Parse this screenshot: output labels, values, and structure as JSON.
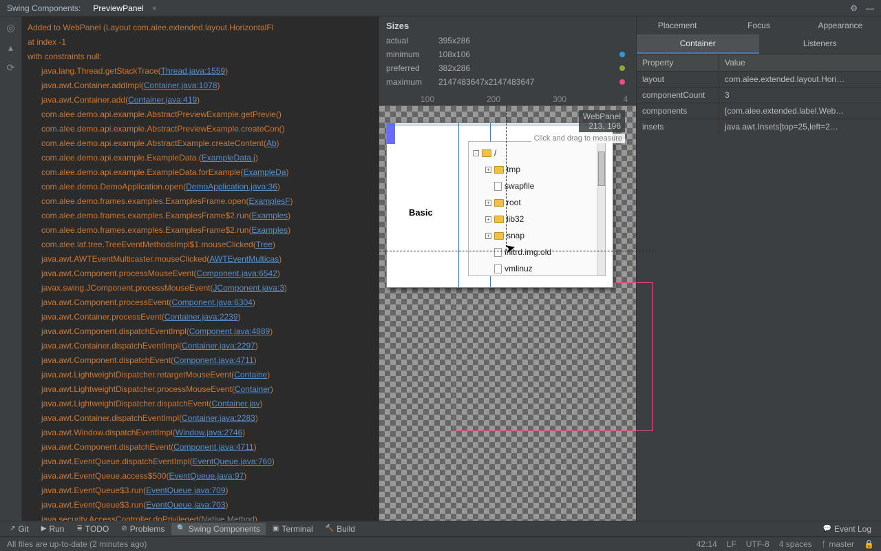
{
  "header": {
    "breadcrumb": "Swing Components:",
    "tab": "PreviewPanel"
  },
  "stack": {
    "header1": "Added to WebPanel (Layout com.alee.extended.layout.HorizontalFl",
    "header2": "at index -1",
    "header3": "with constraints null:",
    "frames": [
      {
        "call": "java.lang.Thread.getStackTrace",
        "src": "Thread.java:1559"
      },
      {
        "call": "java.awt.Container.addImpl",
        "src": "Container.java:1078"
      },
      {
        "call": "java.awt.Container.add",
        "src": "Container.java:419"
      },
      {
        "call": "com.alee.demo.api.example.AbstractPreviewExample.getPrevie",
        "src": ""
      },
      {
        "call": "com.alee.demo.api.example.AbstractPreviewExample.createCon",
        "src": ""
      },
      {
        "call": "com.alee.demo.api.example.AbstractExample.createContent",
        "src": "Ab"
      },
      {
        "call": "com.alee.demo.api.example.ExampleData.<init>",
        "src": "ExampleData.j"
      },
      {
        "call": "com.alee.demo.api.example.ExampleData.forExample",
        "src": "ExampleDa"
      },
      {
        "call": "com.alee.demo.DemoApplication.open",
        "src": "DemoApplication.java:36"
      },
      {
        "call": "com.alee.demo.frames.examples.ExamplesFrame.open",
        "src": "ExamplesF"
      },
      {
        "call": "com.alee.demo.frames.examples.ExamplesFrame$2.run",
        "src": "Examples"
      },
      {
        "call": "com.alee.demo.frames.examples.ExamplesFrame$2.run",
        "src": "Examples"
      },
      {
        "call": "com.alee.laf.tree.TreeEventMethodsImpl$1.mouseClicked",
        "src": "Tree"
      },
      {
        "call": "java.awt.AWTEventMulticaster.mouseClicked",
        "src": "AWTEventMulticas"
      },
      {
        "call": "java.awt.Component.processMouseEvent",
        "src": "Component.java:6542"
      },
      {
        "call": "javax.swing.JComponent.processMouseEvent",
        "src": "JComponent.java:3"
      },
      {
        "call": "java.awt.Component.processEvent",
        "src": "Component.java:6304"
      },
      {
        "call": "java.awt.Container.processEvent",
        "src": "Container.java:2239"
      },
      {
        "call": "java.awt.Component.dispatchEventImpl",
        "src": "Component.java:4889"
      },
      {
        "call": "java.awt.Container.dispatchEventImpl",
        "src": "Container.java:2297"
      },
      {
        "call": "java.awt.Component.dispatchEvent",
        "src": "Component.java:4711"
      },
      {
        "call": "java.awt.LightweightDispatcher.retargetMouseEvent",
        "src": "Containe"
      },
      {
        "call": "java.awt.LightweightDispatcher.processMouseEvent",
        "src": "Container"
      },
      {
        "call": "java.awt.LightweightDispatcher.dispatchEvent",
        "src": "Container.jav"
      },
      {
        "call": "java.awt.Container.dispatchEventImpl",
        "src": "Container.java:2283"
      },
      {
        "call": "java.awt.Window.dispatchEventImpl",
        "src": "Window.java:2746"
      },
      {
        "call": "java.awt.Component.dispatchEvent",
        "src": "Component.java:4711"
      },
      {
        "call": "java.awt.EventQueue.dispatchEventImpl",
        "src": "EventQueue.java:760"
      },
      {
        "call": "java.awt.EventQueue.access$500",
        "src": "EventQueue.java:97"
      },
      {
        "call": "java.awt.EventQueue$3.run",
        "src": "EventQueue.java:709"
      },
      {
        "call": "java.awt.EventQueue$3.run",
        "src": "EventQueue.java:703"
      },
      {
        "call": "java.security.AccessController.doPrivileged",
        "src": "Native Method",
        "gray": true
      }
    ]
  },
  "sizes": {
    "title": "Sizes",
    "rows": [
      {
        "k": "actual",
        "v": "395x286",
        "dot": ""
      },
      {
        "k": "minimum",
        "v": "108x106",
        "dot": "#2d9cdb"
      },
      {
        "k": "preferred",
        "v": "382x286",
        "dot": "#8bae2a"
      },
      {
        "k": "maximum",
        "v": "2147483647x2147483647",
        "dot": "#ef4b8a"
      }
    ],
    "ruler": [
      "100",
      "200",
      "300",
      "4"
    ]
  },
  "preview": {
    "component_name": "WebPanel",
    "coords": "213, 196",
    "hint": "Click and drag to measure",
    "basic_label": "Basic",
    "tree": [
      {
        "exp": "-",
        "type": "folder",
        "label": "/",
        "level": 0
      },
      {
        "exp": "+",
        "type": "folder",
        "label": "tmp",
        "level": 1
      },
      {
        "exp": "",
        "type": "file",
        "label": "swapfile",
        "level": 1
      },
      {
        "exp": "+",
        "type": "folder",
        "label": "root",
        "level": 1
      },
      {
        "exp": "+",
        "type": "folder",
        "label": "lib32",
        "level": 1
      },
      {
        "exp": "+",
        "type": "folder",
        "label": "snap",
        "level": 1
      },
      {
        "exp": "",
        "type": "file",
        "label": "initrd.img.old",
        "level": 1
      },
      {
        "exp": "",
        "type": "file",
        "label": "vmlinuz",
        "level": 1
      }
    ]
  },
  "propTabs1": [
    "Placement",
    "Focus",
    "Appearance"
  ],
  "propTabs2": [
    "Container",
    "Listeners"
  ],
  "propsHeader": {
    "c1": "Property",
    "c2": "Value"
  },
  "props": [
    {
      "k": "layout",
      "v": "com.alee.extended.layout.Hori…"
    },
    {
      "k": "componentCount",
      "v": "3"
    },
    {
      "k": "components",
      "v": "[com.alee.extended.label.Web…"
    },
    {
      "k": "insets",
      "v": "java.awt.Insets[top=25,left=2…"
    }
  ],
  "tools": [
    "Git",
    "Run",
    "TODO",
    "Problems",
    "Swing Components",
    "Terminal",
    "Build"
  ],
  "event_log": "Event Log",
  "status": {
    "left": "All files are up-to-date (2 minutes ago)",
    "pos": "42:14",
    "lf": "LF",
    "enc": "UTF-8",
    "indent": "4 spaces",
    "branch": "master"
  }
}
